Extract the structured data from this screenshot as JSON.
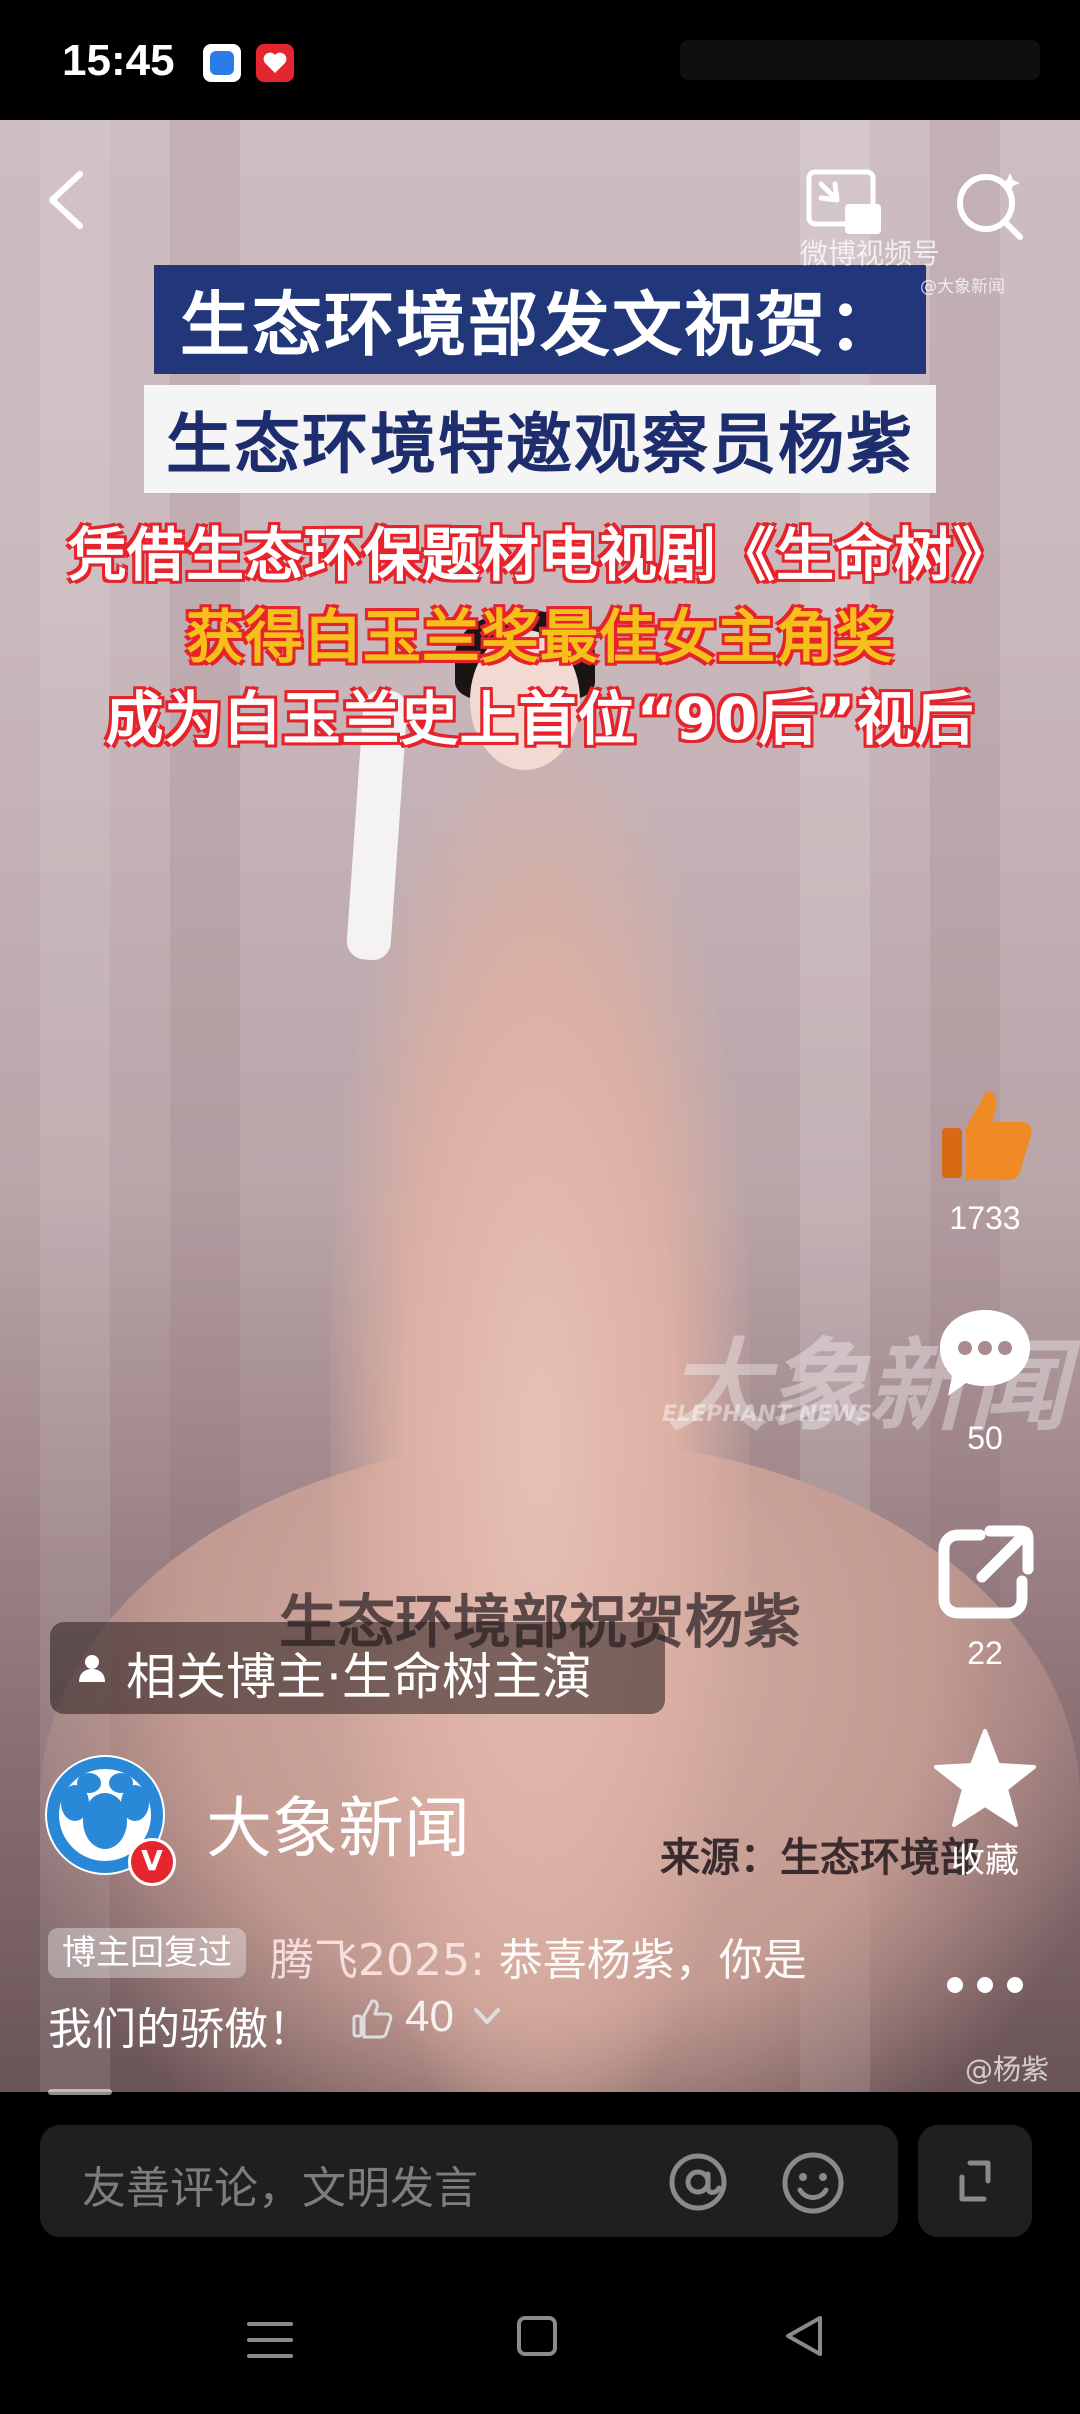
{
  "status_bar": {
    "time": "15:45"
  },
  "video": {
    "headline": {
      "line1": "生态环境部发文祝贺：",
      "line2": "生态环境特邀观察员杨紫",
      "line3": "凭借生态环保题材电视剧《生命树》",
      "line4": "获得白玉兰奖最佳女主角奖",
      "line5": "成为白玉兰史上首位“90后”视后"
    },
    "watermark_top": {
      "text": "微博视频号",
      "handle": "@大象新闻"
    },
    "watermark_brand": {
      "cn": "大象新闻",
      "en": "ELEPHANT NEWS"
    },
    "subtitle": "生态环境部祝贺杨紫",
    "source_text": "来源：生态环境部",
    "corner_watermark": "@杨紫"
  },
  "actions": {
    "like_count": "1733",
    "comment_count": "50",
    "share_count": "22",
    "favorite_label": "收藏"
  },
  "related": {
    "text": "相关博主·生命树主演"
  },
  "author": {
    "name": "大象新闻",
    "verified_badge": "V"
  },
  "top_comment": {
    "badge": "博主回复过",
    "user": "腾飞2025:",
    "text_part1": " 恭喜杨紫，你是",
    "text_part2": "我们的骄傲！",
    "like_count": "40"
  },
  "comment_input": {
    "placeholder": "友善评论，文明发言"
  },
  "colors": {
    "headline_navy": "#223779",
    "headline_red_outline": "#e6232a",
    "headline_yellow": "#f6c01a",
    "like_orange": "#f08a24",
    "background": "#000000"
  },
  "icons": [
    "back-icon",
    "pip-icon",
    "search-icon",
    "like-icon",
    "comment-icon",
    "share-icon",
    "favorite-icon",
    "more-icon",
    "at-icon",
    "emoji-icon",
    "fullscreen-icon",
    "menu-icon",
    "home-icon",
    "nav-back-icon"
  ]
}
